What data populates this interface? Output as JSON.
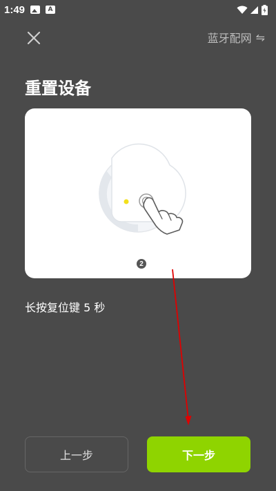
{
  "status_bar": {
    "time": "1:49",
    "notification_icons": [
      "image-icon",
      "a-app-icon"
    ],
    "system_icons": [
      "wifi-icon",
      "signal-icon",
      "battery-icon"
    ]
  },
  "header": {
    "close_icon": "close-icon",
    "mode_label": "蓝牙配网",
    "mode_icon": "⇋"
  },
  "page": {
    "title": "重置设备",
    "instruction": "长按复位键 5 秒",
    "step_number": "2"
  },
  "buttons": {
    "prev_label": "上一步",
    "next_label": "下一步"
  },
  "colors": {
    "background": "#4a4a4a",
    "accent_green": "#8fd400",
    "annotation_red": "#e00000"
  }
}
